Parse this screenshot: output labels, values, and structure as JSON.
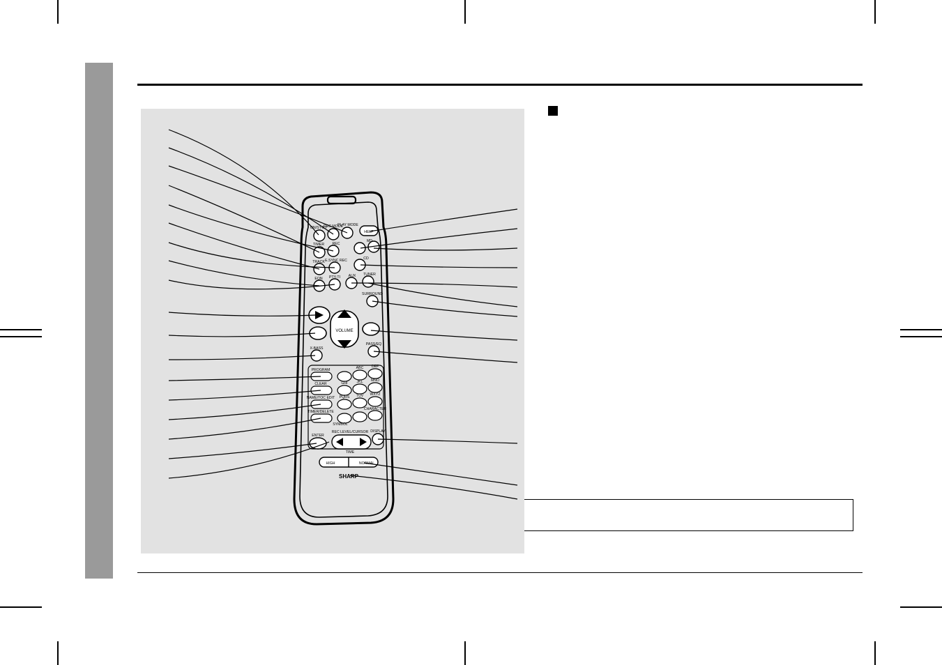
{
  "remote_labels": {
    "on_standby": "ON/ST-BY",
    "rec_mode": "REC MODE",
    "play_mode": "PLAY MODE",
    "help": "HELP",
    "timer": "TIMER",
    "rec": "REC",
    "md": "MD",
    "track": "TRACK",
    "esync_rec": "E.SYNC REC",
    "cd": "CD",
    "eon": "EON",
    "pty_ti": "PTY-TI",
    "aux": "AUX",
    "tuner": "TUNER",
    "surround": "SURROUND",
    "volume": "VOLUME",
    "xbass": "X-BASS",
    "pass_eq": "PASS/EQ",
    "program": "PROGRAM",
    "clear": "CLEAR",
    "name_toc_edit": "NAME/TOC EDIT",
    "timer_delete": "TIMER/DELETE",
    "rec_level_cursor": "REC LEVEL/CURSOR",
    "display": "DISPLAY",
    "enter": "ENTER",
    "time": "TIME",
    "ghi": "GHI",
    "jkl": "JKL",
    "mno": "MNO",
    "abc": "ABC",
    "def": "DEF",
    "pqrs": "PQRS",
    "tuv": "TUV",
    "wxyz": "WXYZ",
    "symbol": "SYMBOL",
    "character": "CHARACTER",
    "high": "HIGH",
    "normal": "NORMAL",
    "brand": "SHARP"
  },
  "colors": {
    "tab_gray": "#9a9a9a",
    "illus_bg": "#e2e2e2"
  }
}
